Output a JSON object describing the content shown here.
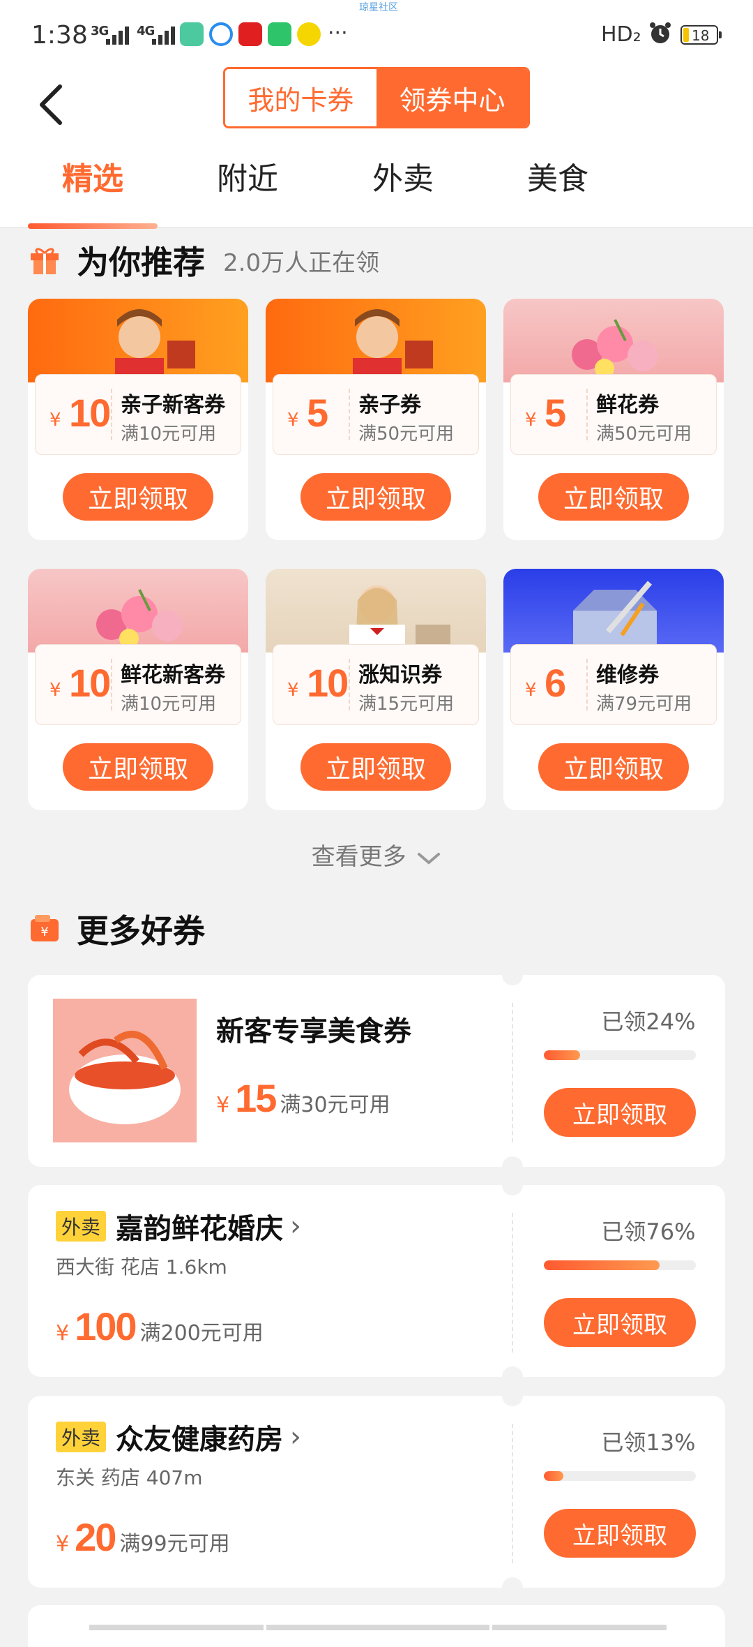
{
  "status_bar": {
    "top_center_label": "琼星社区",
    "time": "1:38",
    "net1": "3G",
    "net2": "4G",
    "more": "···",
    "hd": "HD₂",
    "battery": "18"
  },
  "header": {
    "seg_my": "我的卡券",
    "seg_center": "领券中心"
  },
  "tabs": [
    "精选",
    "附近",
    "外卖",
    "美食"
  ],
  "recommend": {
    "title": "为你推荐",
    "subtitle": "2.0万人正在领",
    "items": [
      {
        "yen": "¥",
        "amount": "10",
        "name": "亲子新客券",
        "cond": "满10元可用",
        "btn": "立即领取"
      },
      {
        "yen": "¥",
        "amount": "5",
        "name": "亲子券",
        "cond": "满50元可用",
        "btn": "立即领取"
      },
      {
        "yen": "¥",
        "amount": "5",
        "name": "鲜花券",
        "cond": "满50元可用",
        "btn": "立即领取"
      },
      {
        "yen": "¥",
        "amount": "10",
        "name": "鲜花新客券",
        "cond": "满10元可用",
        "btn": "立即领取"
      },
      {
        "yen": "¥",
        "amount": "10",
        "name": "涨知识券",
        "cond": "满15元可用",
        "btn": "立即领取"
      },
      {
        "yen": "¥",
        "amount": "6",
        "name": "维修券",
        "cond": "满79元可用",
        "btn": "立即领取"
      }
    ],
    "more_label": "查看更多"
  },
  "more_coupons": {
    "title": "更多好券",
    "items": [
      {
        "name": "新客专享美食券",
        "yen": "¥",
        "amount": "15",
        "cond": "满30元可用",
        "claimed": "已领24%",
        "progress": 0.24,
        "btn": "立即领取"
      },
      {
        "tag": "外卖",
        "name": "嘉韵鲜花婚庆",
        "info": "西大街 花店 1.6km",
        "yen": "¥",
        "amount": "100",
        "cond": "满200元可用",
        "claimed": "已领76%",
        "progress": 0.76,
        "btn": "立即领取"
      },
      {
        "tag": "外卖",
        "name": "众友健康药房",
        "info": "东关 药店 407m",
        "yen": "¥",
        "amount": "20",
        "cond": "满99元可用",
        "claimed": "已领13%",
        "progress": 0.13,
        "btn": "立即领取"
      }
    ]
  },
  "colors": {
    "accent": "#ff6a30",
    "tag": "#ffd23a"
  }
}
